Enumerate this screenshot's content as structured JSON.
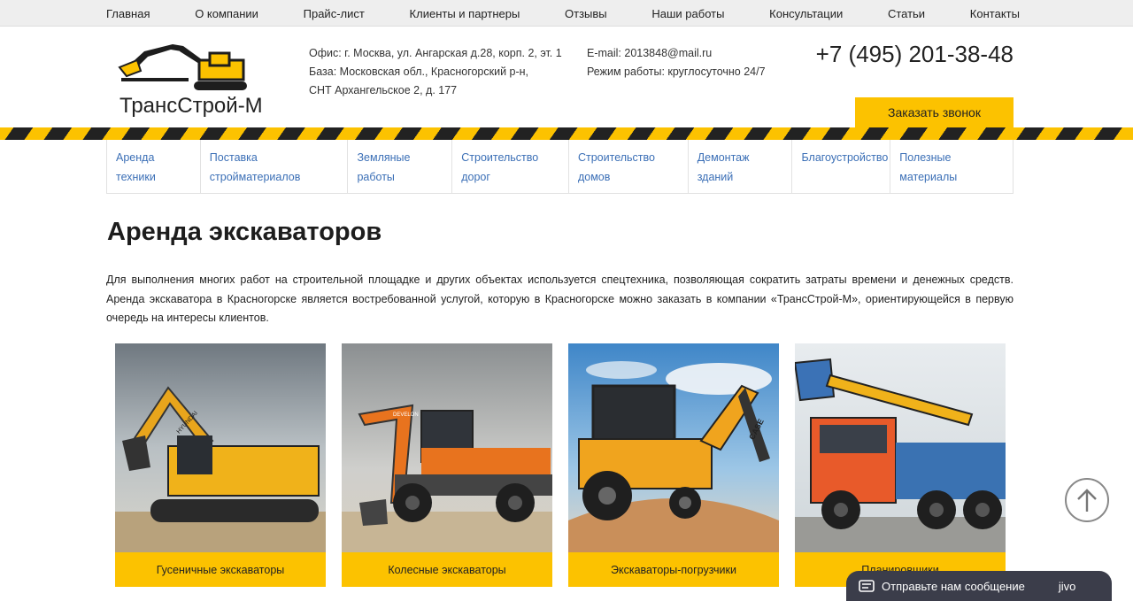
{
  "topnav": {
    "items": [
      "Главная",
      "О компании",
      "Прайс-лист",
      "Клиенты и партнеры",
      "Отзывы",
      "Наши работы",
      "Консультации",
      "Статьи",
      "Контакты"
    ]
  },
  "logo": {
    "text": "ТрансСтрой-М"
  },
  "header": {
    "address_lines": [
      "Офис: г. Москва, ул. Ангарская д.28, корп. 2, эт. 1",
      "База: Московская обл., Красногорский р-н,",
      "СНТ Архангельское 2, д. 177"
    ],
    "email": "E-mail: 2013848@mail.ru",
    "hours": "Режим работы: круглосуточно 24/7",
    "phone": "+7 (495) 201-38-48",
    "call_button": "Заказать звонок"
  },
  "services": [
    {
      "l1": "Аренда",
      "l2": "техники"
    },
    {
      "l1": "Поставка",
      "l2": "стройматериалов"
    },
    {
      "l1": "Земляные",
      "l2": "работы"
    },
    {
      "l1": "Строительство",
      "l2": "дорог"
    },
    {
      "l1": "Строительство",
      "l2": "домов"
    },
    {
      "l1": "Демонтаж",
      "l2": "зданий"
    },
    {
      "l1": "Благоустройство",
      "l2": ""
    },
    {
      "l1": "Полезные",
      "l2": "материалы"
    }
  ],
  "main": {
    "title": "Аренда экскаваторов",
    "intro": "Для выполнения многих работ на строительной площадке и других объектах используется спецтехника, позволяющая сократить затраты времени и денежных средств. Аренда экскаватора в Красногорске является востребованной услугой, которую в Красногорске можно заказать в компании «ТрансСтрой-М», ориентирующейся в первую очередь на интересы клиентов."
  },
  "cards": [
    {
      "label": "Гусеничные экскаваторы",
      "brand": "HYUNDAI"
    },
    {
      "label": "Колесные экскаваторы",
      "brand": "DEVELON"
    },
    {
      "label": "Экскаваторы-погрузчики",
      "brand": "CASE"
    },
    {
      "label": "Планировщики",
      "brand": ""
    }
  ],
  "chat": {
    "text": "Отправьте нам сообщение",
    "brand": "jivo"
  },
  "colors": {
    "accent": "#fcc200",
    "link": "#3b6fb6",
    "chat_bg": "#3b3d4a"
  }
}
